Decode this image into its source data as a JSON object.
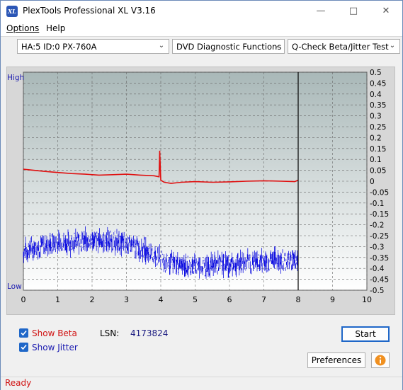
{
  "app": {
    "title": "PlexTools Professional XL V3.16",
    "icon_text": "XL"
  },
  "window_controls": [
    "minimize-icon",
    "maximize-icon",
    "close-icon"
  ],
  "menu": {
    "options_label": "Options",
    "help_label": "Help"
  },
  "toolbar": {
    "drive_select": "HA:5 ID:0  PX-760A",
    "function_select": "DVD Diagnostic Functions",
    "test_select": "Q-Check Beta/Jitter Test"
  },
  "chart_data": {
    "type": "line",
    "left_axis_labels": {
      "top": "High",
      "bottom": "Low"
    },
    "x_ticks": [
      "0",
      "1",
      "2",
      "3",
      "4",
      "5",
      "6",
      "7",
      "8",
      "9",
      "10"
    ],
    "xlim": [
      0,
      10
    ],
    "y_ticks": [
      "0.5",
      "0.45",
      "0.4",
      "0.35",
      "0.3",
      "0.25",
      "0.2",
      "0.15",
      "0.1",
      "0.05",
      "0",
      "-0.05",
      "-0.1",
      "-0.15",
      "-0.2",
      "-0.25",
      "-0.3",
      "-0.35",
      "-0.4",
      "-0.45",
      "-0.5"
    ],
    "ylim": [
      -0.5,
      0.5
    ],
    "grid": true,
    "end_marker_x": 8,
    "colors": {
      "beta": "#e01010",
      "jitter": "#1010e0"
    },
    "series": [
      {
        "key": "beta",
        "x": [
          0,
          0.3,
          0.6,
          1,
          1.4,
          1.8,
          2.2,
          2.6,
          3,
          3.4,
          3.8,
          3.95,
          3.97,
          4.0,
          4.1,
          4.3,
          4.6,
          5,
          5.5,
          6,
          6.5,
          7,
          7.5,
          7.9,
          8
        ],
        "values": [
          0.055,
          0.05,
          0.045,
          0.04,
          0.035,
          0.032,
          0.028,
          0.03,
          0.032,
          0.028,
          0.025,
          0.02,
          0.14,
          0.005,
          -0.005,
          -0.01,
          -0.005,
          -0.002,
          -0.005,
          -0.003,
          0.0,
          0.002,
          0.0,
          -0.002,
          0.005
        ]
      },
      {
        "key": "jitter",
        "x": [
          0,
          0.4,
          0.8,
          1.2,
          1.6,
          2,
          2.4,
          2.8,
          3.2,
          3.6,
          4,
          4.4,
          4.8,
          5.2,
          5.6,
          6,
          6.4,
          6.8,
          7.2,
          7.6,
          8
        ],
        "values": [
          -0.32,
          -0.3,
          -0.29,
          -0.28,
          -0.28,
          -0.27,
          -0.27,
          -0.28,
          -0.3,
          -0.32,
          -0.36,
          -0.38,
          -0.39,
          -0.39,
          -0.38,
          -0.38,
          -0.37,
          -0.37,
          -0.36,
          -0.36,
          -0.36
        ],
        "spread": 0.045
      }
    ]
  },
  "controls": {
    "show_beta_label": "Show Beta",
    "show_jitter_label": "Show Jitter",
    "show_beta_checked": true,
    "show_jitter_checked": true,
    "lsn_label": "LSN:",
    "lsn_value": "4173824",
    "start_label": "Start",
    "preferences_label": "Preferences",
    "info_icon": "info-icon"
  },
  "status": {
    "text": "Ready"
  }
}
